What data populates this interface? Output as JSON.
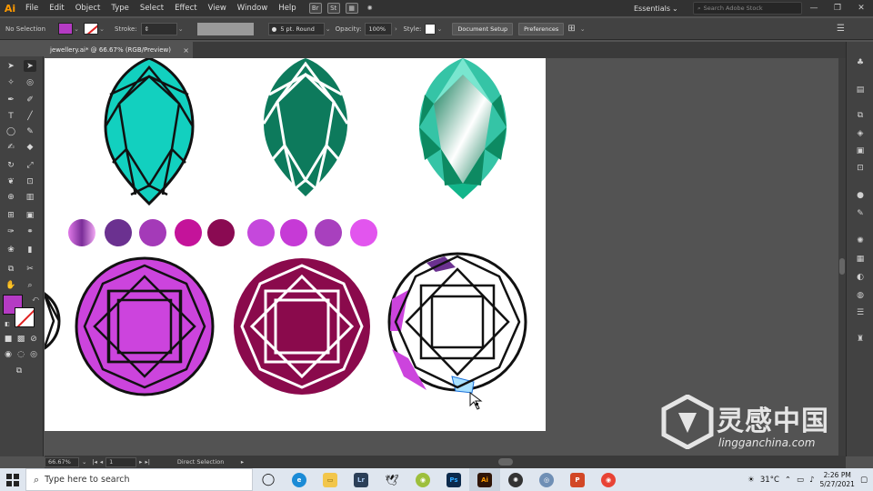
{
  "app": {
    "logo": "Ai",
    "menu": [
      "File",
      "Edit",
      "Object",
      "Type",
      "Select",
      "Effect",
      "View",
      "Window",
      "Help"
    ],
    "workspace": "Essentials",
    "search_placeholder": "Search Adobe Stock",
    "window_controls": [
      "—",
      "❐",
      "✕"
    ]
  },
  "control_bar": {
    "selection": "No Selection",
    "stroke_label": "Stroke:",
    "brush": "5 pt. Round",
    "opacity_label": "Opacity:",
    "opacity_value": "100%",
    "style_label": "Style:",
    "document_setup": "Document Setup",
    "preferences": "Preferences",
    "fill_color": "#b53bc4"
  },
  "document": {
    "tab_title": "jewellery.ai* @ 66.67% (RGB/Preview)",
    "close": "×"
  },
  "swatches": [
    "#c95ad6",
    "#6b3190",
    "#a43ab8",
    "#c4139a",
    "#8a0a52",
    "#c548dc",
    "#c63ad6",
    "#a840be",
    "#e255ee"
  ],
  "gem_colors": {
    "teal": "#12d0bf",
    "green": "#0d7a5c",
    "purple": "#cc44dd",
    "maroon": "#8a0a4c"
  },
  "status_bar": {
    "zoom": "66.67%",
    "artboard": "1",
    "tool": "Direct Selection"
  },
  "taskbar": {
    "search_placeholder": "Type here to search",
    "temperature": "31°C",
    "time": "2:26 PM",
    "date": "5/27/2021",
    "apps": [
      {
        "label": "Lr",
        "color": "#2b3f57"
      },
      {
        "label": "Ps",
        "color": "#0c2a4c"
      },
      {
        "label": "Ai",
        "color": "#2f1406"
      },
      {
        "label": "P",
        "color": "#d24726"
      }
    ]
  },
  "watermark": {
    "main": "灵感中国",
    "sub": "lingganchina.com"
  }
}
